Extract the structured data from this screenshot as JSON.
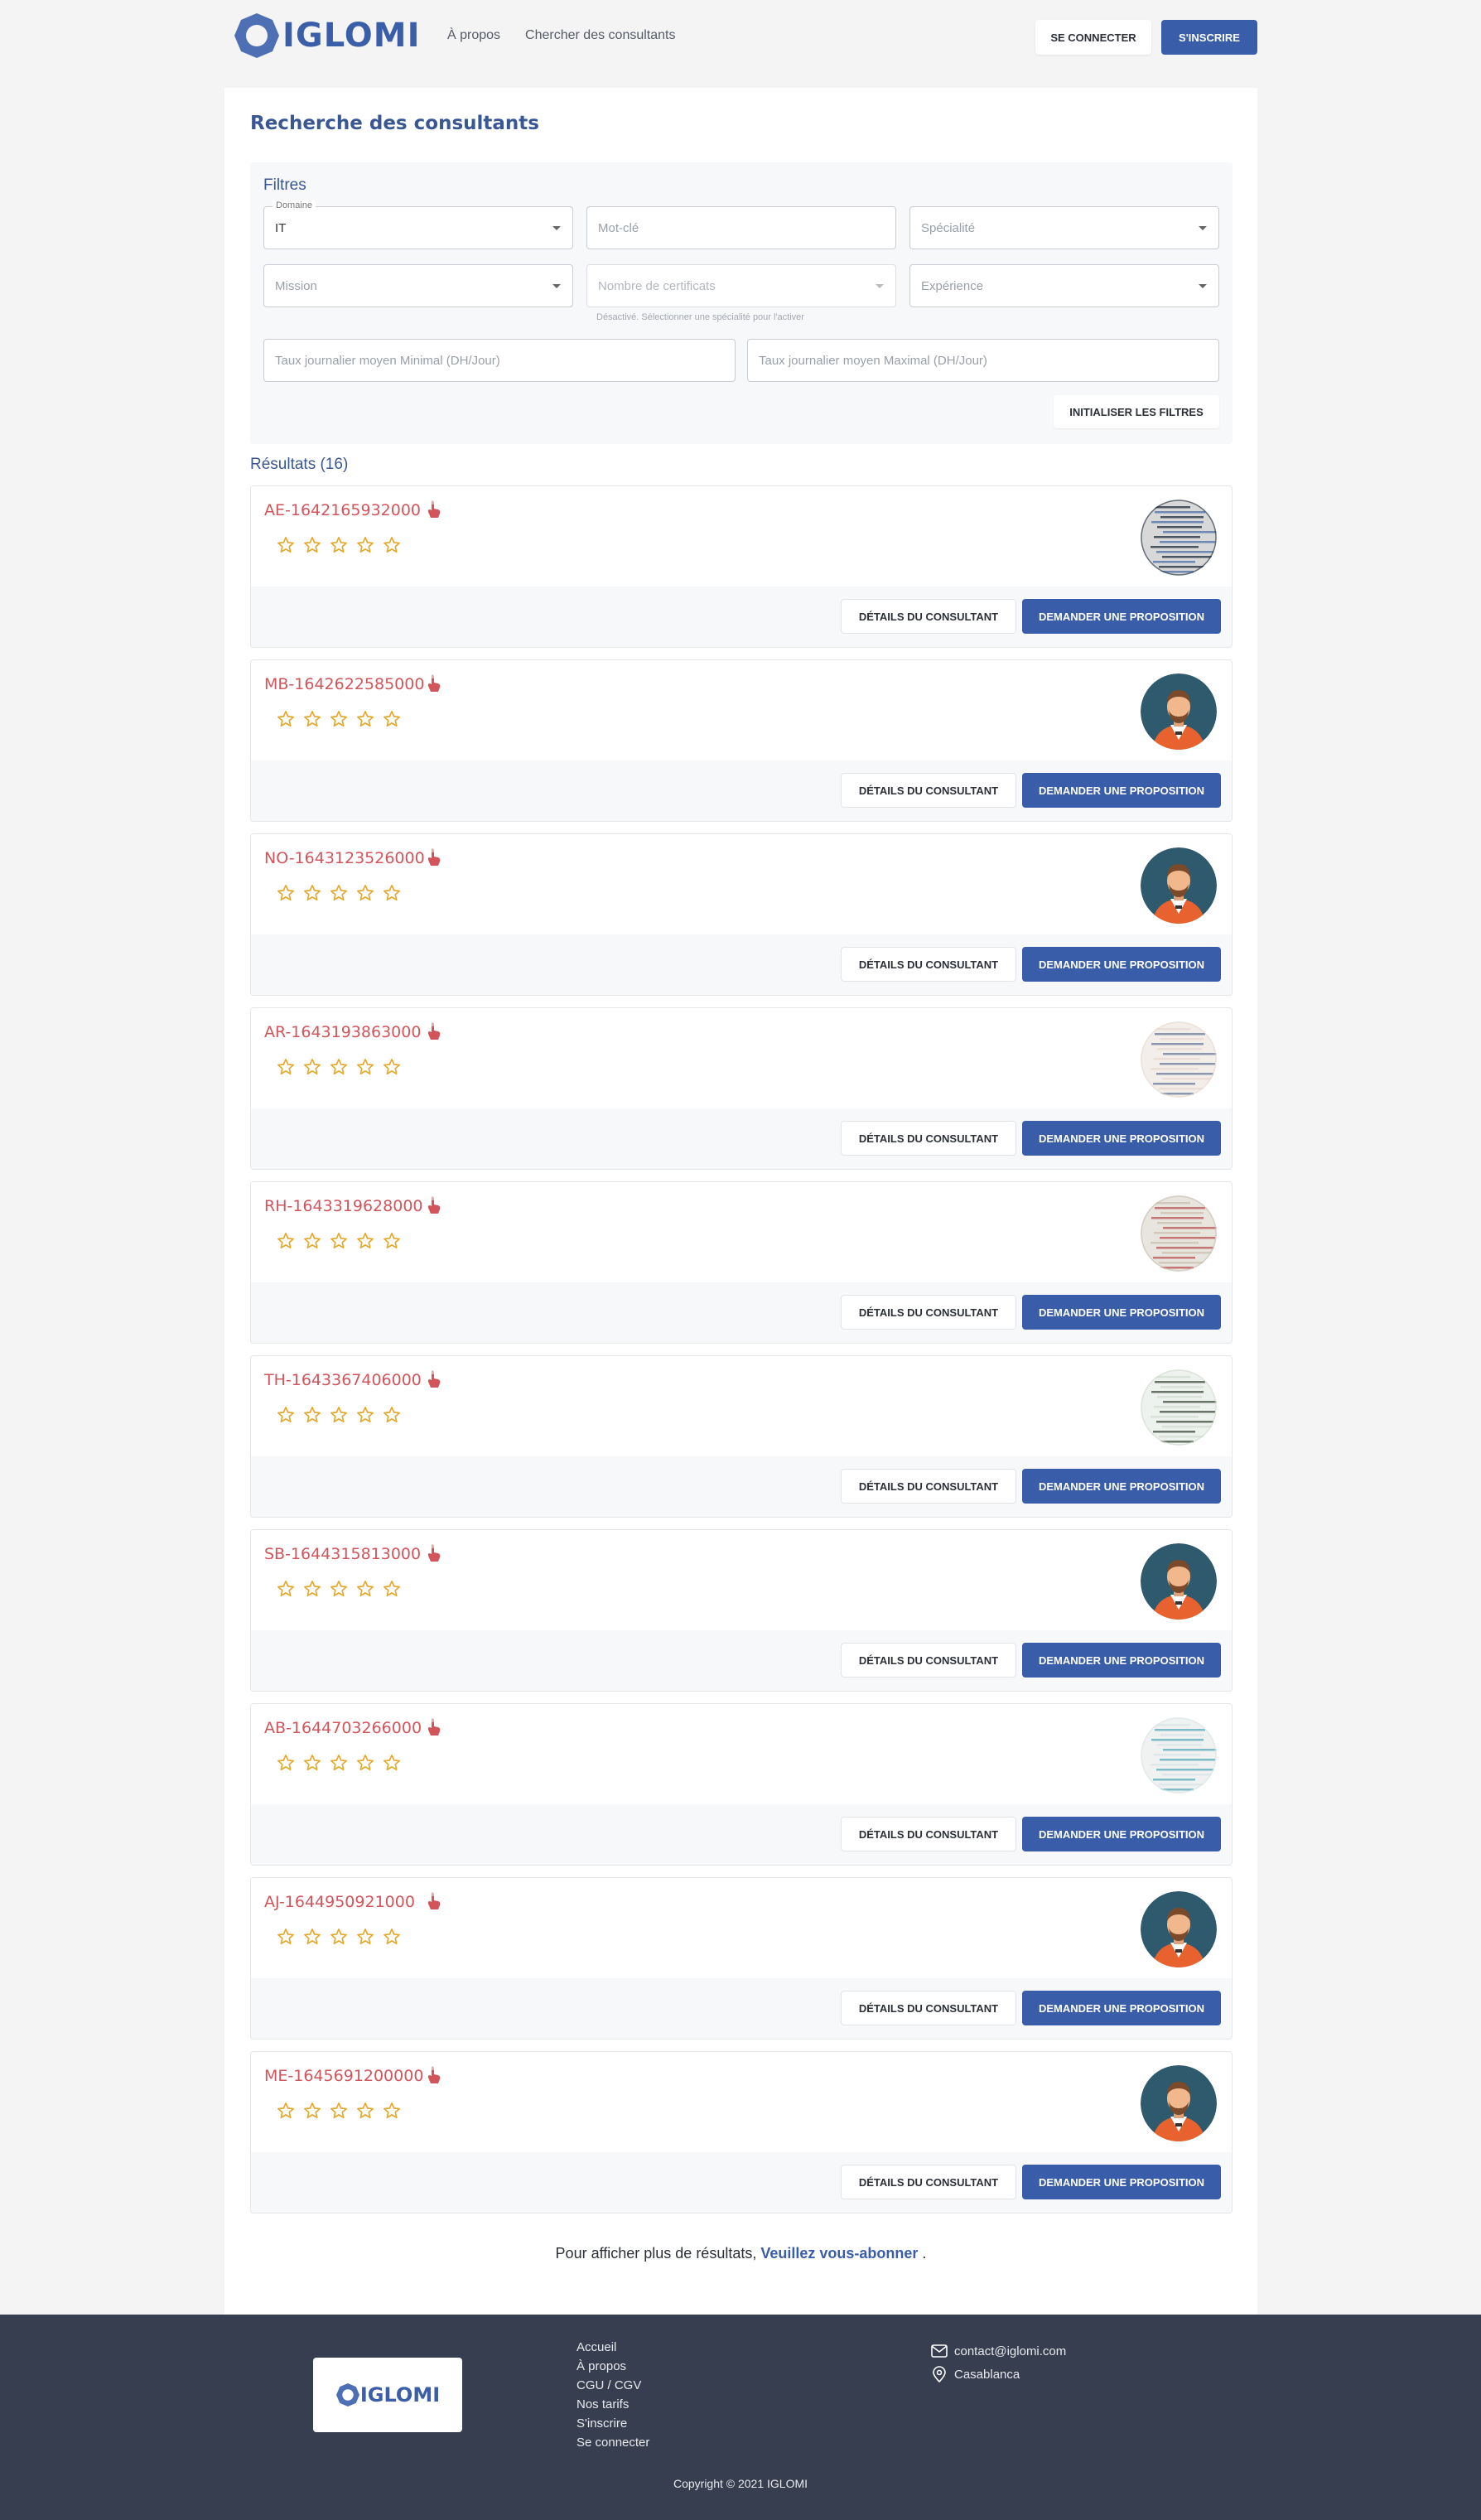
{
  "header": {
    "brand": "IGLOMI",
    "nav": [
      "À propos",
      "Chercher des consultants"
    ],
    "login": "SE CONNECTER",
    "signup": "S'INSCRIRE"
  },
  "page": {
    "title": "Recherche des consultants"
  },
  "filters": {
    "title": "Filtres",
    "domaine_label": "Domaine",
    "domaine_value": "IT",
    "keyword_placeholder": "Mot-clé",
    "specialite_placeholder": "Spécialité",
    "mission_placeholder": "Mission",
    "certificats_placeholder": "Nombre de certificats",
    "certificats_helper": "Désactivé. Sélectionner une spécialité pour l'activer",
    "experience_placeholder": "Expérience",
    "taux_min_placeholder": "Taux journalier moyen Minimal (DH/Jour)",
    "taux_max_placeholder": "Taux journalier moyen Maximal (DH/Jour)",
    "reset": "INITIALISER LES FILTRES"
  },
  "results": {
    "title": "Résultats (16)",
    "details_label": "DÉTAILS DU CONSULTANT",
    "propose_label": "DEMANDER UNE PROPOSITION",
    "items": [
      {
        "id": "AE-1642165932000",
        "rating": 0,
        "avatar": "photo-blue"
      },
      {
        "id": "MB-1642622585000",
        "rating": 0,
        "avatar": "default-man"
      },
      {
        "id": "NO-1643123526000",
        "rating": 0,
        "avatar": "default-man"
      },
      {
        "id": "AR-1643193863000",
        "rating": 0,
        "avatar": "photo-light"
      },
      {
        "id": "RH-1643319628000",
        "rating": 0,
        "avatar": "photo-red"
      },
      {
        "id": "TH-1643367406000",
        "rating": 0,
        "avatar": "photo-green"
      },
      {
        "id": "SB-1644315813000",
        "rating": 0,
        "avatar": "default-man"
      },
      {
        "id": "AB-1644703266000",
        "rating": 0,
        "avatar": "photo-cyan"
      },
      {
        "id": "AJ-1644950921000",
        "rating": 0,
        "avatar": "default-man"
      },
      {
        "id": "ME-1645691200000",
        "rating": 0,
        "avatar": "default-man"
      }
    ]
  },
  "more": {
    "text": "Pour afficher plus de résultats,",
    "link": "Veuillez vous-abonner",
    "suffix": " ."
  },
  "footer": {
    "brand": "IGLOMI",
    "links": [
      "Accueil",
      "À propos",
      "CGU / CGV",
      "Nos tarifs",
      "S'inscrire",
      "Se connecter"
    ],
    "email": "contact@iglomi.com",
    "city": "Casablanca",
    "copyright": "Copyright © 2021 IGLOMI"
  },
  "colors": {
    "brand": "#3a5daa",
    "id_text": "#d2555b",
    "star": "#e5a82b",
    "footer_bg": "#363e50"
  }
}
